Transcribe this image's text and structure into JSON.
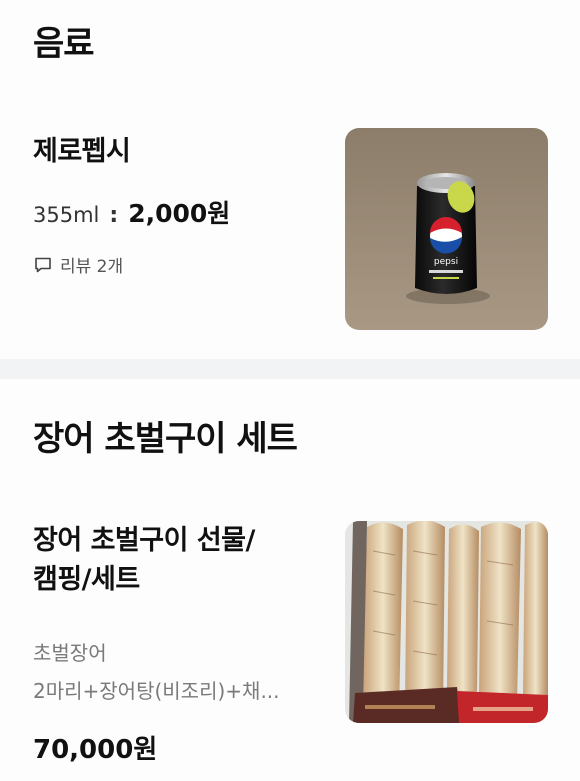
{
  "categories": [
    {
      "title": "음료",
      "items": [
        {
          "name": "제로펩시",
          "option": "355ml",
          "price": "2,000원",
          "review_label": "리뷰 2개",
          "image": "pepsi-zero-can-photo"
        }
      ]
    },
    {
      "title": "장어 초벌구이 세트",
      "items": [
        {
          "name_line1": "장어 초벌구이 선물/",
          "name_line2": "캠핑/세트",
          "desc_line1": "초벌장어",
          "desc_line2": "2마리+장어탕(비조리)+채...",
          "price": "70,000원",
          "image": "grilled-eel-set-photo"
        }
      ]
    }
  ],
  "icons": {
    "review": "speech-bubble-icon"
  },
  "colors": {
    "divider": "#f2f3f5",
    "text_primary": "#111111",
    "text_secondary": "#7a7a7a"
  }
}
